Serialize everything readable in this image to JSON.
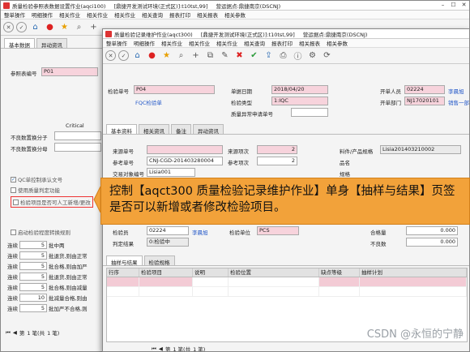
{
  "back_window": {
    "title_segments": [
      "质量检验参照表数据设置作业(aqci100)",
      "[鼎捷开发测试环境(正式区)]:t10tst,99]",
      "营运据点:鼎捷南京(DSCNJ)"
    ],
    "menu": [
      "整单操作",
      "明细操作",
      "相关作业",
      "相关作业",
      "相关作业",
      "相关查询",
      "报表打印",
      "相关报表",
      "相关参数"
    ],
    "tabs": [
      "基本数据",
      "异动资讯"
    ],
    "ref_label": "参照表编号",
    "ref_value": "P01",
    "critical_label": "Critical",
    "defect_labels": [
      "不良数置换分子",
      "不良数置换分母"
    ],
    "checkboxes": [
      "QC单控制承认文号",
      "使用质量判定功能",
      "检验项目是否可人工新增/更改"
    ],
    "sampling_checkbox": "启动检验程度转换规则",
    "rules_label": "连续",
    "rules": [
      {
        "n": "5",
        "text": "批中两"
      },
      {
        "n": "5",
        "text": "批退货,则由正常"
      },
      {
        "n": "5",
        "text": "批合格,则由加严"
      },
      {
        "n": "5",
        "text": "批退货,则由正常"
      },
      {
        "n": "5",
        "text": "批合格,则由减量"
      },
      {
        "n": "10",
        "text": "批减量合格,则由"
      },
      {
        "n": "5",
        "text": "批加严不合格,则"
      }
    ],
    "pager_prefix": "第",
    "pager_text": "1 笔(共",
    "pager_suffix": "1 笔)"
  },
  "front_window": {
    "title_segments": [
      "质量检验记录维护作业(aqct300)",
      "[鼎捷开发测试环境(正式区)]:t10tst,99]",
      "营运据点:鼎捷南京(DSCNJ)"
    ],
    "menu": [
      "整单操作",
      "明细操作",
      "相关作业",
      "相关作业",
      "相关作业",
      "相关查询",
      "报表打印",
      "相关报表",
      "相关参数"
    ],
    "header_fields": {
      "inspect_no_label": "检验单号",
      "inspect_no": "P04",
      "doc_date_label": "单据日期",
      "doc_date": "2018/04/20",
      "inspect_type_label": "检验类型",
      "inspect_type": "1:IQC",
      "fqc_link": "FQC检验单",
      "quality_label": "质量异常申请单号",
      "inspector_label": "开单人员",
      "inspector": "02224",
      "inspector_name": "李晨旭",
      "dept_label": "开单部门",
      "dept": "NJ17020101",
      "dept_name": "销售一部"
    },
    "tabs": [
      "基本资料",
      "相关资讯",
      "备注",
      "异动资讯"
    ],
    "basic": {
      "source_no_label": "来源单号",
      "source_no": "",
      "source_item_label": "来源项次",
      "source_item": "2",
      "ref_no_label": "参考单号",
      "ref_no": "CNJ-CGD-201403280004",
      "ref_item_label": "参考项次",
      "ref_item": "2",
      "trade_label": "交易对象编号",
      "trade": "Lisia001",
      "part_label": "料件/产品规格",
      "part": "Lisia201403210002",
      "name_label": "品名",
      "spec_label": "规格",
      "inspector2_label": "检验员",
      "inspector2": "02224",
      "inspector2_name": "李晨旭",
      "unit_label": "检验单位",
      "unit": "PCS",
      "result_label": "判定结果",
      "result": "0:检验中",
      "qualified_label": "合格量",
      "qualified": "0.000",
      "unqualified_label": "不良数",
      "unqualified": "0.000"
    },
    "sub_tabs": [
      "抽样与结果",
      "检验规格"
    ],
    "grid_headers": [
      "行序",
      "检验项目",
      "说明",
      "检验位置",
      "缺点等级",
      "抽样计划"
    ],
    "pager_prefix": "第",
    "pager_text": "1 笔(共",
    "pager_suffix": "1 笔)"
  },
  "callout": {
    "text": "控制【aqct300 质量检验记录维护作业】单身【抽样与结果】页签是否可以新增或者修改检验项目。"
  },
  "watermark": "CSDN @永恒的宁静"
}
